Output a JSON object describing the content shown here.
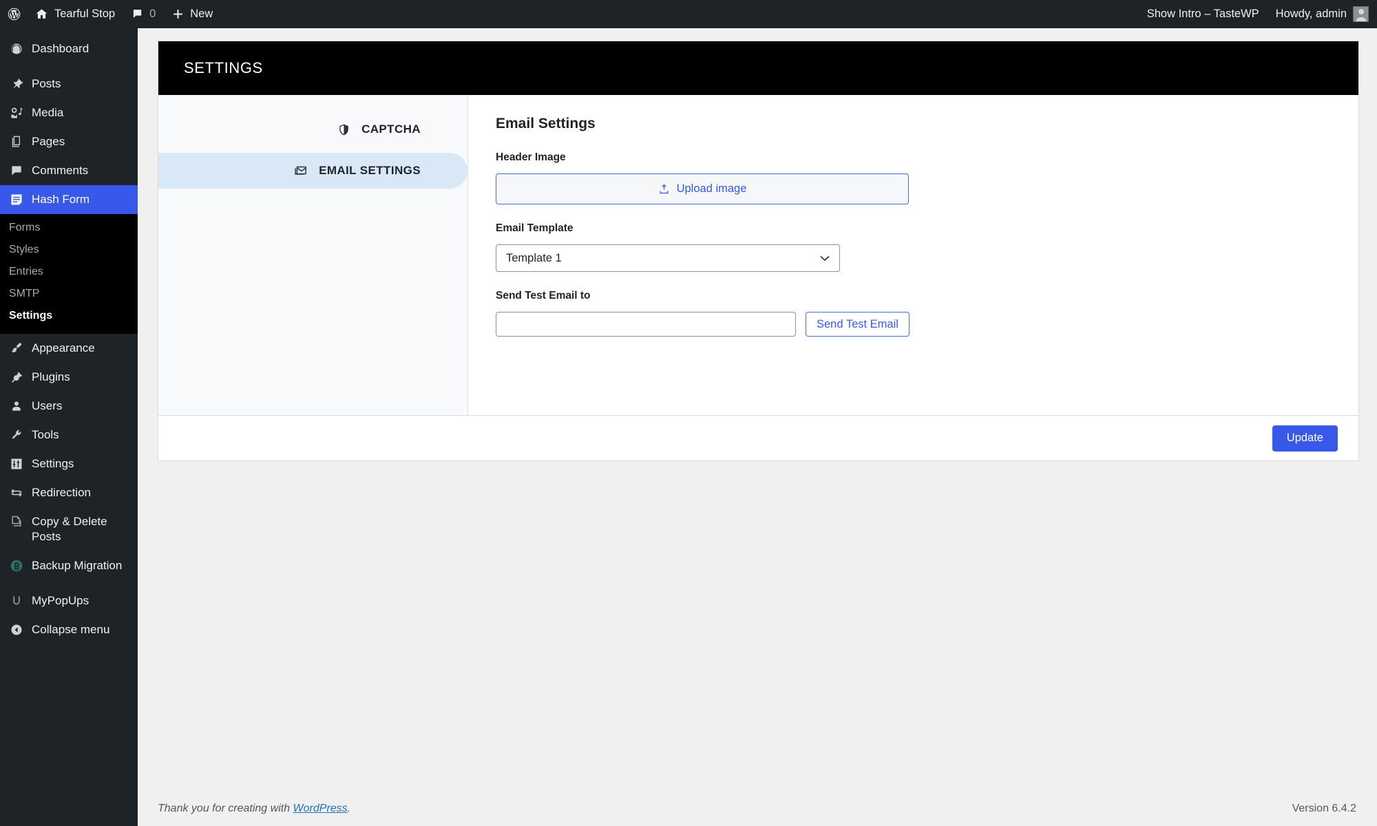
{
  "adminbar": {
    "logo_icon": "wordpress-logo-icon",
    "site_icon": "home-icon",
    "site_name": "Tearful Stop",
    "comments_icon": "comment-bubble-icon",
    "comments_count": "0",
    "new_icon": "plus-icon",
    "new_label": "New",
    "intro_label": "Show Intro – TasteWP",
    "howdy_label": "Howdy, admin",
    "avatar": "user-avatar"
  },
  "sidebar": {
    "items": [
      {
        "label": "Dashboard",
        "icon": "dashboard-icon",
        "current": false
      },
      {
        "label": "Posts",
        "icon": "pin-icon",
        "current": false
      },
      {
        "label": "Media",
        "icon": "media-icon",
        "current": false
      },
      {
        "label": "Pages",
        "icon": "pages-icon",
        "current": false
      },
      {
        "label": "Comments",
        "icon": "comment-bubble-icon",
        "current": false
      },
      {
        "label": "Hash Form",
        "icon": "form-icon",
        "current": true
      },
      {
        "label": "Appearance",
        "icon": "paintbrush-icon",
        "current": false
      },
      {
        "label": "Plugins",
        "icon": "plug-icon",
        "current": false
      },
      {
        "label": "Users",
        "icon": "user-icon",
        "current": false
      },
      {
        "label": "Tools",
        "icon": "wrench-icon",
        "current": false
      },
      {
        "label": "Settings",
        "icon": "sliders-icon",
        "current": false
      },
      {
        "label": "Redirection",
        "icon": "redirect-arrows-icon",
        "current": false
      },
      {
        "label": "Copy & Delete Posts",
        "icon": "copy-posts-icon",
        "current": false
      },
      {
        "label": "Backup Migration",
        "icon": "backup-migration-icon",
        "current": false
      },
      {
        "label": "MyPopUps",
        "icon": "mypopups-icon",
        "current": false
      },
      {
        "label": "Collapse menu",
        "icon": "collapse-arrow-icon",
        "current": false
      }
    ],
    "submenu": [
      {
        "label": "Forms",
        "current": false
      },
      {
        "label": "Styles",
        "current": false
      },
      {
        "label": "Entries",
        "current": false
      },
      {
        "label": "SMTP",
        "current": false
      },
      {
        "label": "Settings",
        "current": true
      }
    ]
  },
  "panel": {
    "header_title": "SETTINGS",
    "tabs": [
      {
        "label": "CAPTCHA",
        "icon": "shield-icon",
        "active": false
      },
      {
        "label": "EMAIL SETTINGS",
        "icon": "mail-icon",
        "active": true
      }
    ],
    "settings": {
      "heading": "Email Settings",
      "header_image_label": "Header Image",
      "upload_button_label": "Upload image",
      "upload_icon": "upload-icon",
      "email_template_label": "Email Template",
      "email_template_value": "Template 1",
      "email_template_options": [
        "Template 1"
      ],
      "send_test_email_label": "Send Test Email to",
      "send_test_email_value": "",
      "send_test_email_placeholder": "",
      "send_test_email_button": "Send Test Email"
    },
    "update_button_label": "Update"
  },
  "footer": {
    "thanks_prefix": "Thank you for creating with ",
    "wordpress_link": "WordPress",
    "thanks_suffix": ".",
    "version": "Version 6.4.2"
  },
  "colors": {
    "accent_blue": "#3858e9",
    "admin_dark": "#1d2327",
    "tab_active_bg": "#d8e8f6",
    "panel_header_bg": "#000000"
  }
}
